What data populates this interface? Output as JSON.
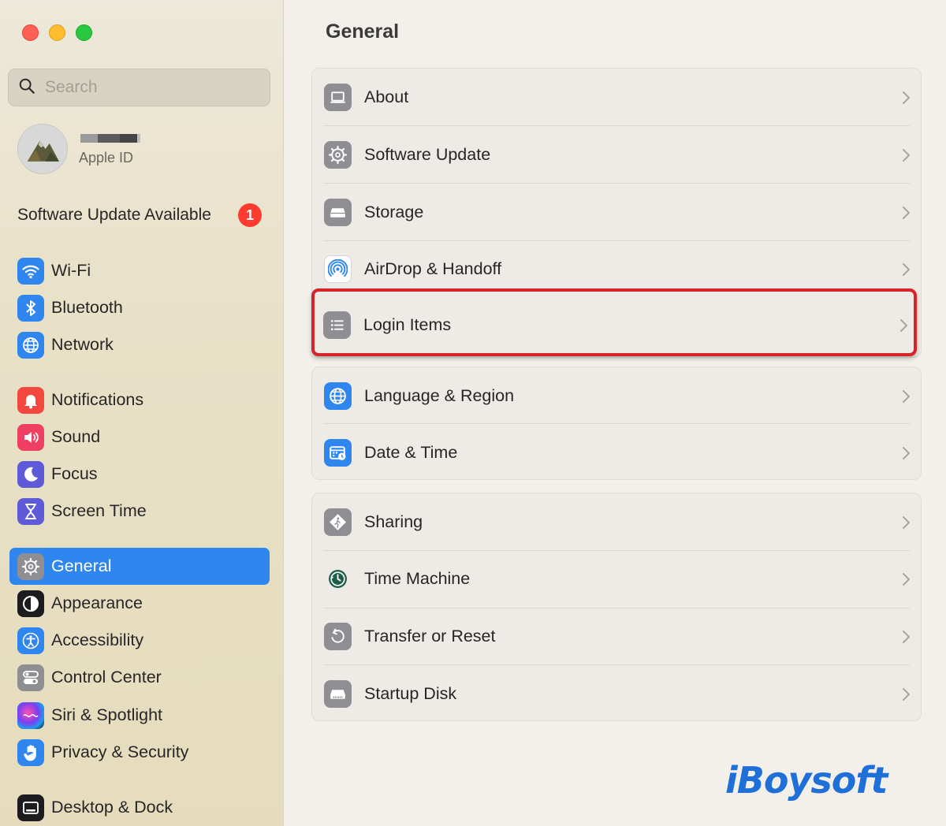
{
  "window": {
    "title": "General"
  },
  "search": {
    "placeholder": "Search"
  },
  "account": {
    "subtitle": "Apple ID"
  },
  "software_update": {
    "label": "Software Update Available",
    "badge": "1"
  },
  "sidebar": {
    "items": [
      {
        "label": "Wi-Fi",
        "icon": "wifi-icon"
      },
      {
        "label": "Bluetooth",
        "icon": "bluetooth-icon"
      },
      {
        "label": "Network",
        "icon": "globe-icon"
      },
      {
        "label": "Notifications",
        "icon": "bell-icon"
      },
      {
        "label": "Sound",
        "icon": "speaker-icon"
      },
      {
        "label": "Focus",
        "icon": "moon-icon"
      },
      {
        "label": "Screen Time",
        "icon": "hourglass-icon"
      },
      {
        "label": "General",
        "icon": "gear-icon",
        "selected": true
      },
      {
        "label": "Appearance",
        "icon": "appearance-icon"
      },
      {
        "label": "Accessibility",
        "icon": "accessibility-icon"
      },
      {
        "label": "Control Center",
        "icon": "toggles-icon"
      },
      {
        "label": "Siri & Spotlight",
        "icon": "siri-icon"
      },
      {
        "label": "Privacy & Security",
        "icon": "hand-icon"
      },
      {
        "label": "Desktop & Dock",
        "icon": "dock-icon"
      }
    ]
  },
  "main": {
    "title": "General",
    "groups": [
      [
        {
          "label": "About",
          "icon": "laptop-icon"
        },
        {
          "label": "Software Update",
          "icon": "gear-icon"
        },
        {
          "label": "Storage",
          "icon": "drive-icon"
        },
        {
          "label": "AirDrop & Handoff",
          "icon": "airdrop-icon"
        },
        {
          "label": "Login Items",
          "icon": "list-icon"
        }
      ],
      [
        {
          "label": "Language & Region",
          "icon": "globe-icon"
        },
        {
          "label": "Date & Time",
          "icon": "calendar-icon"
        }
      ],
      [
        {
          "label": "Sharing",
          "icon": "sharing-icon"
        },
        {
          "label": "Time Machine",
          "icon": "time-machine-icon"
        },
        {
          "label": "Transfer or Reset",
          "icon": "reset-icon"
        },
        {
          "label": "Startup Disk",
          "icon": "disk-icon"
        }
      ]
    ]
  },
  "colors": {
    "accent": "#2f86ef",
    "badge": "#ff3b30",
    "highlight": "#d6242b",
    "watermark": "#1f6fd8"
  },
  "watermark": {
    "text": "iBoysoft"
  }
}
